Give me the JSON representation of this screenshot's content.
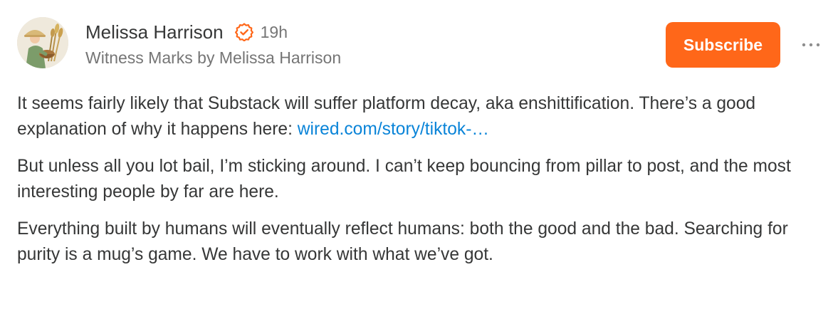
{
  "note": {
    "author": {
      "name": "Melissa Harrison",
      "publication": "Witness Marks by Melissa Harrison",
      "timestamp": "19h"
    },
    "subscribe_label": "Subscribe",
    "paragraphs": [
      {
        "text": "It seems fairly likely that Substack will suffer platform decay, aka enshittification. There’s a good explanation of why it happens here: ",
        "link": "wired.com/story/tiktok-…"
      },
      {
        "text": "But unless all you lot bail, I’m sticking around. I can’t keep bouncing from pillar to post, and the most interesting people by far are here."
      },
      {
        "text": "Everything built by humans will eventually reflect humans: both the good and the bad. Searching for purity is a mug’s game. We have to work with what we’ve got."
      }
    ]
  },
  "icons": {
    "verified": "verified-badge-icon",
    "more": "more-options-icon"
  },
  "colors": {
    "accent": "#ff6719",
    "link": "#0a84d8",
    "text": "#363737",
    "meta": "#757575"
  }
}
